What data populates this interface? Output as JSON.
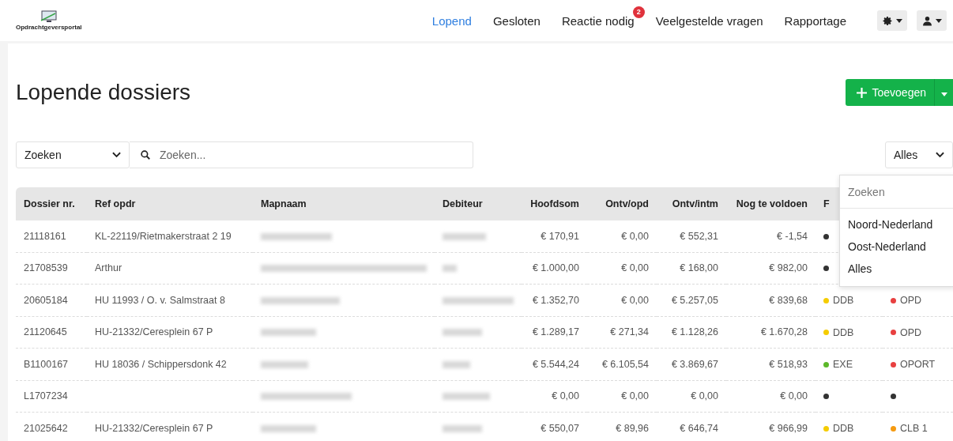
{
  "logo": {
    "text": "Opdrachtgeversportal"
  },
  "nav": [
    {
      "label": "Lopend",
      "selected": true
    },
    {
      "label": "Gesloten",
      "selected": false
    },
    {
      "label": "Reactie nodig",
      "selected": false,
      "badge": "2"
    },
    {
      "label": "Veelgestelde vragen",
      "selected": false
    },
    {
      "label": "Rapportage",
      "selected": false
    }
  ],
  "page_title": "Lopende dossiers",
  "add_button": {
    "label": "Toevoegen"
  },
  "search": {
    "field_select": "Zoeken",
    "placeholder": "Zoeken..."
  },
  "region_filter": {
    "value": "Alles"
  },
  "region_menu": {
    "search_placeholder": "Zoeken",
    "options": [
      "Noord-Nederland",
      "Oost-Nederland",
      "Alles"
    ]
  },
  "table": {
    "columns": [
      "Dossier nr.",
      "Ref opdr",
      "Mapnaam",
      "Debiteur",
      "Hoofdsom",
      "Ontv/opd",
      "Ontv/intm",
      "Nog te voldoen",
      "F"
    ],
    "rows": [
      {
        "dossier": "21118161",
        "ref": "KL-22119/Rietmakerstraat 2 19",
        "amounts": [
          "€ 170,91",
          "€ 0,00",
          "€ 552,31",
          "€ -1,54"
        ],
        "status_1": {
          "color": "#333333"
        }
      },
      {
        "dossier": "21708539",
        "ref": "Arthur",
        "amounts": [
          "€ 1.000,00",
          "€ 0,00",
          "€ 168,00",
          "€ 982,00"
        ],
        "status_1": {
          "color": "#333333"
        }
      },
      {
        "dossier": "20605184",
        "ref": "HU 11993 / O. v. Salmstraat 8",
        "amounts": [
          "€ 1.352,70",
          "€ 0,00",
          "€ 5.257,05",
          "€ 839,68"
        ],
        "status_1": {
          "label": "DDB",
          "color": "#f5cc00"
        },
        "status_2": {
          "label": "OPD",
          "color": "#e84040"
        }
      },
      {
        "dossier": "21120645",
        "ref": "HU-21332/Ceresplein 67 P",
        "amounts": [
          "€ 1.289,17",
          "€ 271,34",
          "€ 1.128,26",
          "€ 1.670,28"
        ],
        "status_1": {
          "label": "DDB",
          "color": "#f5cc00"
        },
        "status_2": {
          "label": "OPD",
          "color": "#e84040"
        }
      },
      {
        "dossier": "B1100167",
        "ref": "HU 18036 / Schippersdonk 42",
        "amounts": [
          "€ 5.544,24",
          "€ 6.105,54",
          "€ 3.869,67",
          "€ 518,93"
        ],
        "status_1": {
          "label": "EXE",
          "color": "#5cb82a"
        },
        "status_2": {
          "label": "OPORT",
          "color": "#e84040"
        }
      },
      {
        "dossier": "L1707234",
        "amounts": [
          "€ 0,00",
          "€ 0,00",
          "€ 0,00",
          "€ 0,00"
        ],
        "status_1": {
          "color": "#333333"
        },
        "status_2": {
          "color": "#333333"
        }
      },
      {
        "dossier": "21025642",
        "ref": "HU-21332/Ceresplein 67 P",
        "amounts": [
          "€ 550,07",
          "€ 89,96",
          "€ 646,74",
          "€ 966,99"
        ],
        "status_1": {
          "label": "DDB",
          "color": "#f5cc00"
        },
        "status_2": {
          "label": "CLB 1",
          "color": "#f59a10"
        }
      }
    ]
  }
}
